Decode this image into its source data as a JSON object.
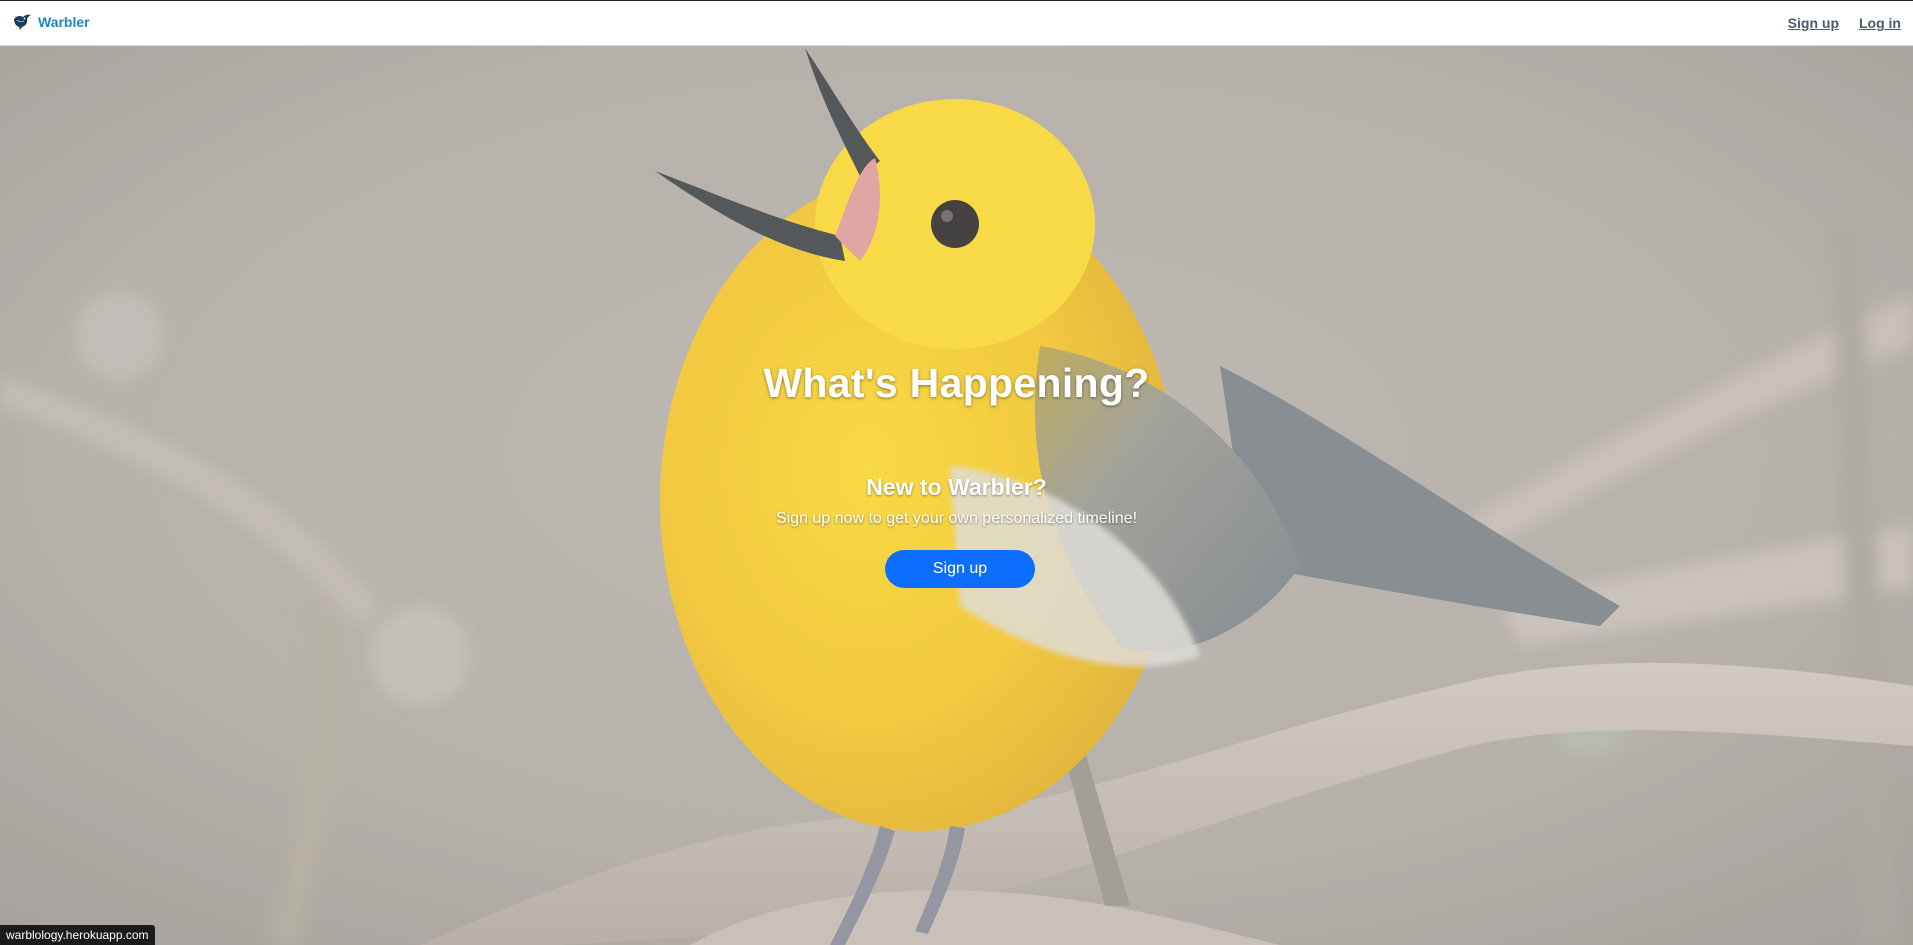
{
  "navbar": {
    "brand_name": "Warbler",
    "signup_label": "Sign up",
    "login_label": "Log in"
  },
  "hero": {
    "title": "What's Happening?",
    "subtitle": "New to Warbler?",
    "tagline": "Sign up now to get your own personalized timeline!",
    "signup_button_label": "Sign up"
  },
  "status_bar": {
    "url": "warblology.herokuapp.com"
  },
  "colors": {
    "brand": "#1d86c8",
    "primary_button": "#0d6efd",
    "nav_link": "#4a5b6e"
  },
  "icons": {
    "brand_logo": "bird-logo-icon"
  }
}
